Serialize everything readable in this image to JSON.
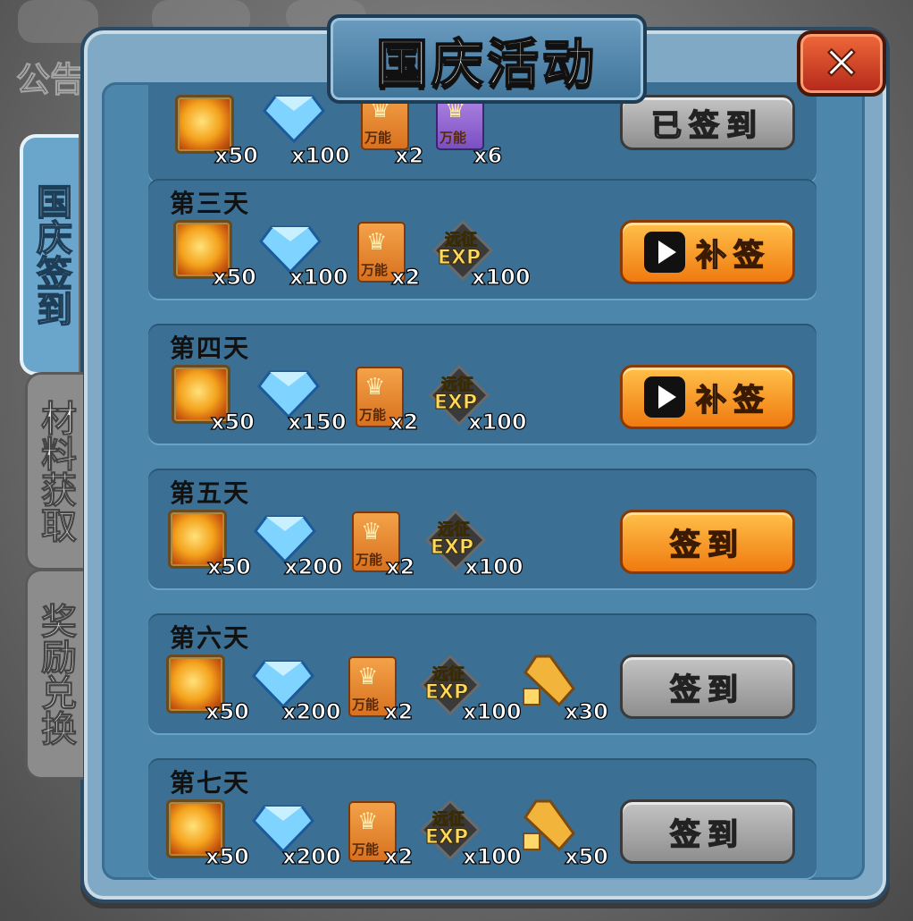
{
  "title": "国庆活动",
  "background": {
    "notice_label": "公告"
  },
  "tabs": [
    {
      "label": "国庆签到",
      "active": true
    },
    {
      "label": "材料获取",
      "active": false
    },
    {
      "label": "奖励兑换",
      "active": false
    }
  ],
  "rows": [
    {
      "title": "",
      "button": "已签到",
      "button_style": "gray",
      "rewards": {
        "gold": "x50",
        "gem": "x100",
        "card": "x2",
        "card2": "x6"
      }
    },
    {
      "title": "第三天",
      "button": "补签",
      "button_style": "orange-video",
      "rewards": {
        "gold": "x50",
        "gem": "x100",
        "card": "x2",
        "exp": "x100"
      }
    },
    {
      "title": "第四天",
      "button": "补签",
      "button_style": "orange-video",
      "rewards": {
        "gold": "x50",
        "gem": "x150",
        "card": "x2",
        "exp": "x100"
      }
    },
    {
      "title": "第五天",
      "button": "签到",
      "button_style": "orange",
      "rewards": {
        "gold": "x50",
        "gem": "x200",
        "card": "x2",
        "exp": "x100"
      }
    },
    {
      "title": "第六天",
      "button": "签到",
      "button_style": "gray",
      "rewards": {
        "gold": "x50",
        "gem": "x200",
        "card": "x2",
        "exp": "x100",
        "frag": "x30"
      }
    },
    {
      "title": "第七天",
      "button": "签到",
      "button_style": "gray",
      "rewards": {
        "gold": "x50",
        "gem": "x200",
        "card": "x2",
        "exp": "x100",
        "frag": "x50"
      }
    }
  ],
  "icons": {
    "card_label": "万能",
    "exp_top": "远征",
    "exp_bottom": "EXP"
  },
  "colors": {
    "panel": "#7fa9c4",
    "row": "#3b6f94",
    "orange_button": "#f07a10",
    "gray_button": "#8e8e8e",
    "close_button": "#b3271a"
  }
}
